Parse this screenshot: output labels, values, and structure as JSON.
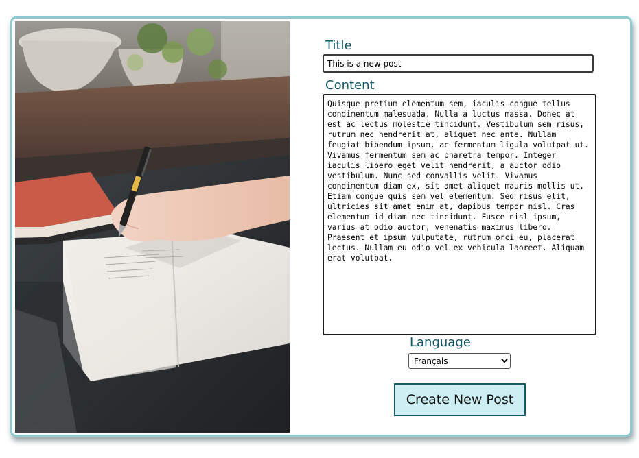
{
  "form": {
    "title_label": "Title",
    "title_value": "This is a new post",
    "content_label": "Content",
    "content_value": "Quisque pretium elementum sem, iaculis congue tellus condimentum malesuada. Nulla a luctus massa. Donec at est ac lectus molestie tincidunt. Vestibulum sem risus, rutrum nec hendrerit at, aliquet nec ante. Nullam feugiat bibendum ipsum, ac fermentum ligula volutpat ut. Vivamus fermentum sem ac pharetra tempor. Integer iaculis libero eget velit hendrerit, a auctor odio vestibulum. Nunc sed convallis velit. Vivamus condimentum diam ex, sit amet aliquet mauris mollis ut. Etiam congue quis sem vel elementum. Sed risus elit, ultricies sit amet enim at, dapibus tempor nisl. Cras elementum id diam nec tincidunt. Fusce nisl ipsum, varius at odio auctor, venenatis maximus libero. Praesent et ipsum vulputate, rutrum orci eu, placerat lectus. Nullam eu odio vel ex vehicula laoreet. Aliquam erat volutpat.",
    "language_label": "Language",
    "language_selected": "Français",
    "submit_label": "Create New Post"
  },
  "colors": {
    "accent": "#0f5a66",
    "card_border": "#8ec9cf",
    "button_bg": "#cdeef2"
  }
}
